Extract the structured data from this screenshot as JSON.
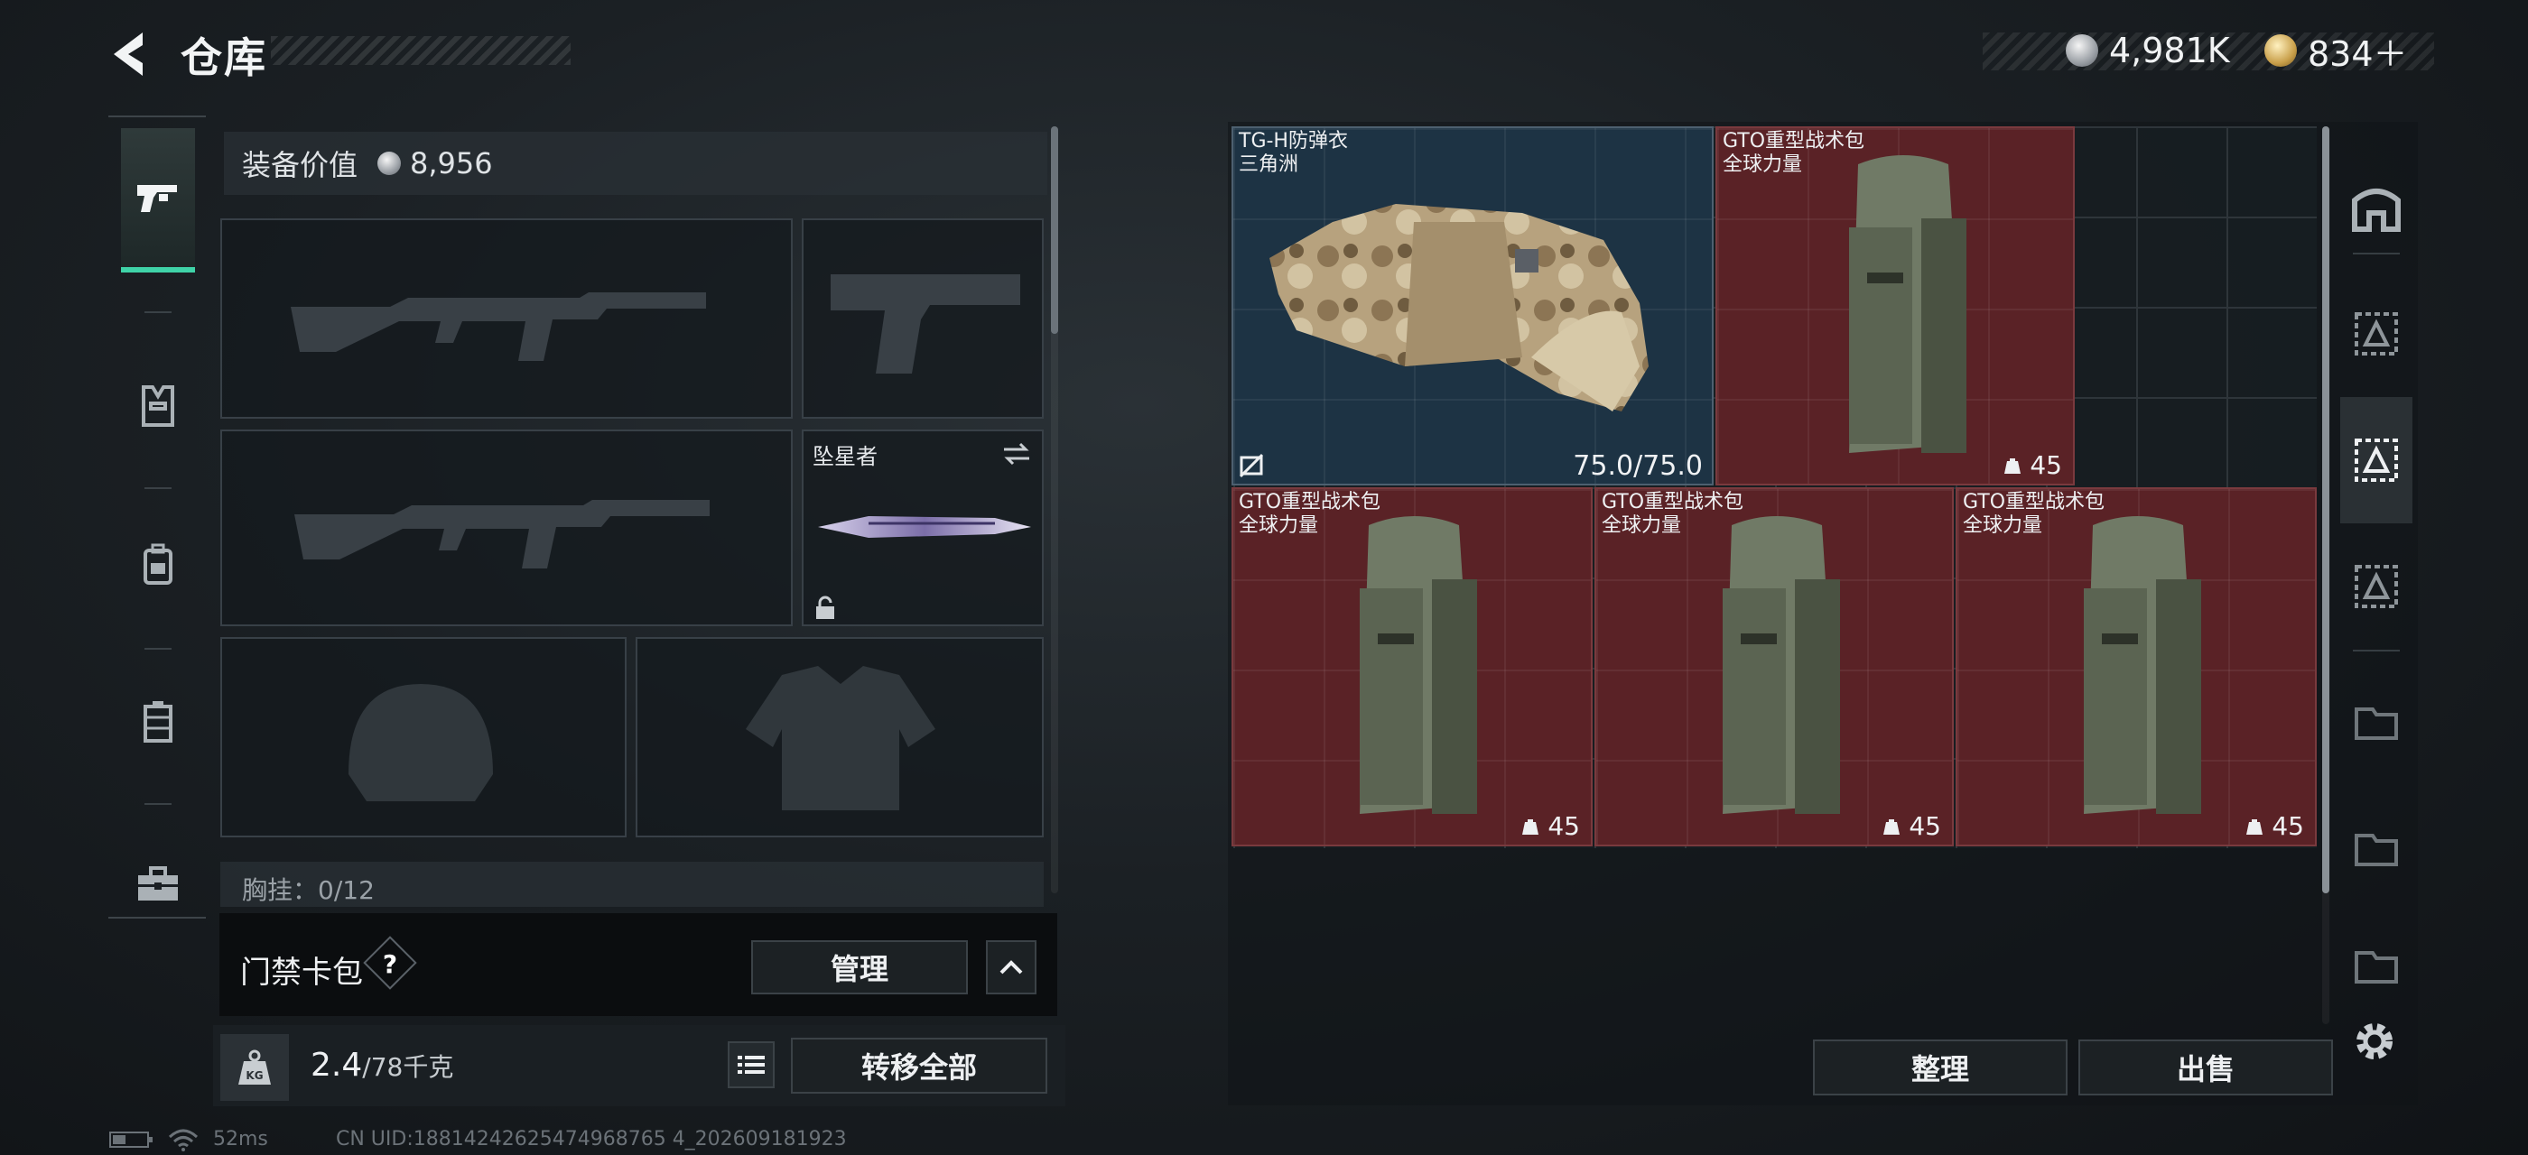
{
  "header": {
    "title": "仓库",
    "currencies": [
      {
        "icon": "silver-coin-icon",
        "value": "4,981K"
      },
      {
        "icon": "gold-coin-icon",
        "value": "834＋"
      }
    ]
  },
  "left_nav": {
    "items": [
      {
        "name": "weapons",
        "icon": "pistol-icon",
        "active": true
      },
      {
        "name": "armor",
        "icon": "vest-icon",
        "active": false
      },
      {
        "name": "backpack",
        "icon": "backpack-icon",
        "active": false
      },
      {
        "name": "chest-rig",
        "icon": "rig-icon",
        "active": false
      },
      {
        "name": "case",
        "icon": "briefcase-icon",
        "active": false
      }
    ]
  },
  "loadout": {
    "equip_value_label": "装备价值",
    "equip_value": "8,956",
    "melee_label": "坠星者",
    "chest_rig_label": "胸挂：0/12",
    "keycard_label": "门禁卡包",
    "help": "?",
    "manage_label": "管理",
    "weight_value": "2.4",
    "weight_capacity": "/78千克",
    "transfer_all_label": "转移全部"
  },
  "stash": {
    "items": [
      {
        "name": "TG-H防弹衣",
        "sub": "三角洲",
        "durability": "75.0/75.0",
        "color": "blue"
      },
      {
        "name": "GTO重型战术包",
        "sub": "全球力量",
        "count": "45",
        "color": "red"
      },
      {
        "name": "GTO重型战术包",
        "sub": "全球力量",
        "count": "45",
        "color": "red"
      },
      {
        "name": "GTO重型战术包",
        "sub": "全球力量",
        "count": "45",
        "color": "red"
      },
      {
        "name": "GTO重型战术包",
        "sub": "全球力量",
        "count": "45",
        "color": "red"
      }
    ],
    "sort_label": "整理",
    "sell_label": "出售"
  },
  "status_bar": {
    "ping": "52ms",
    "uid": "CN UID:18814242625474968765 4_202609181923"
  },
  "colors": {
    "accent": "#3fd3a8",
    "item_red": "#5a2226",
    "item_blue": "#1d3344"
  }
}
